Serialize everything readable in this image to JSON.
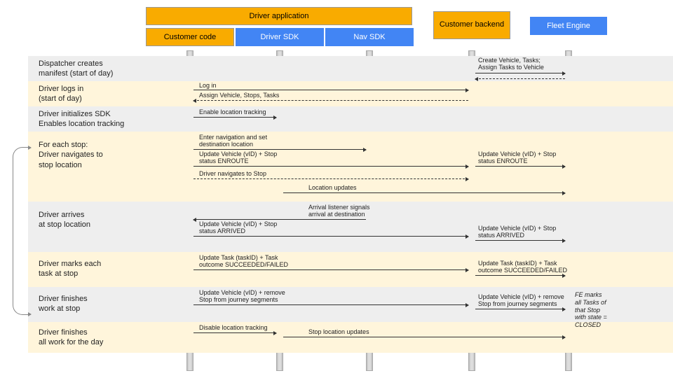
{
  "headers": {
    "driver_app": "Driver application",
    "customer_code": "Customer code",
    "driver_sdk": "Driver SDK",
    "nav_sdk": "Nav SDK",
    "customer_backend": "Customer backend",
    "fleet_engine": "Fleet Engine"
  },
  "rows": {
    "r1": "Dispatcher creates\nmanifest (start of day)",
    "r2": "Driver logs in\n(start of day)",
    "r3": "Driver initializes SDK\nEnables location tracking",
    "r4": "For each stop:\nDriver navigates to\nstop location",
    "r5": "Driver arrives\nat stop location",
    "r6": "Driver marks each\ntask at stop",
    "r7": "Driver finishes\nwork at stop",
    "r8": "Driver finishes\nall work for the day"
  },
  "msgs": {
    "create_vehicle": "Create Vehicle, Tasks;\nAssign Tasks to Vehicle",
    "log_in": "Log in",
    "assign_vehicle": "Assign Vehicle, Stops, Tasks",
    "enable_tracking": "Enable location tracking",
    "enter_nav": "Enter navigation and set\ndestination location",
    "update_enroute": "Update Vehicle (vID) + Stop\nstatus ENROUTE",
    "update_enroute2": "Update Vehicle (vID) + Stop\nstatus ENROUTE",
    "navigates": "Driver navigates to Stop",
    "loc_updates": "Location updates",
    "arrival_listener": "Arrival listener signals\narrival at destination",
    "update_arrived": "Update Vehicle (vID) + Stop\nstatus ARRIVED",
    "update_arrived2": "Update Vehicle (vID) + Stop\nstatus ARRIVED",
    "update_task": "Update Task (taskID) + Task\noutcome SUCCEEDED/FAILED",
    "update_task2": "Update Task (taskID) + Task\noutcome SUCCEEDED/FAILED",
    "remove_stop": "Update Vehicle (vID) + remove\nStop from journey segments",
    "remove_stop2": "Update Vehicle (vID) + remove\nStop from journey segments",
    "disable_tracking": "Disable location tracking",
    "stop_loc_updates": "Stop location updates",
    "fe_note": "FE marks\nall Tasks of\nthat Stop\nwith state =\nCLOSED"
  }
}
